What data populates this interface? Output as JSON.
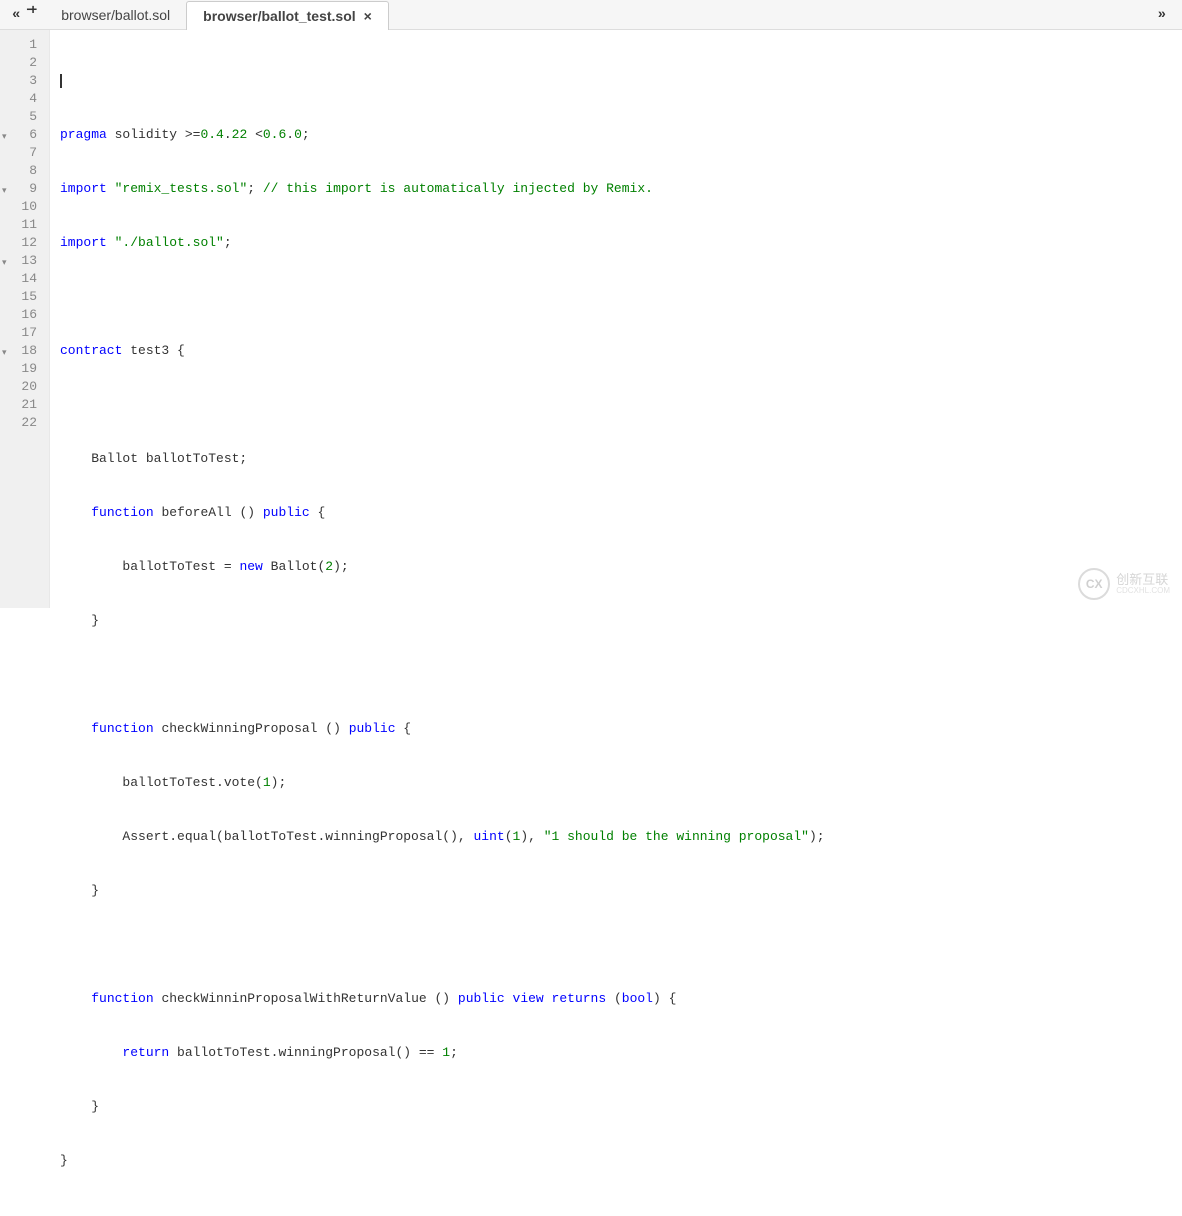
{
  "topbar": {
    "scroll_left": "«",
    "minus": "−",
    "plus": "+",
    "scroll_right": "»"
  },
  "tabs": [
    {
      "label": "browser/ballot.sol",
      "active": false
    },
    {
      "label": "browser/ballot_test.sol",
      "active": true,
      "close": "×"
    }
  ],
  "gutter": {
    "lines": [
      "1",
      "2",
      "3",
      "4",
      "5",
      "6",
      "7",
      "8",
      "9",
      "10",
      "11",
      "12",
      "13",
      "14",
      "15",
      "16",
      "17",
      "18",
      "19",
      "20",
      "21",
      "22"
    ],
    "folds": {
      "5": "▾",
      "8": "▾",
      "12": "▾",
      "17": "▾"
    }
  },
  "code": {
    "l1_cursor": "",
    "l2_a": "pragma",
    "l2_b": " solidity >=",
    "l2_c": "0.4",
    "l2_d": ".",
    "l2_e": "22",
    "l2_f": " <",
    "l2_g": "0.6",
    "l2_h": ".",
    "l2_i": "0",
    "l2_j": ";",
    "l3_a": "import",
    "l3_b": " ",
    "l3_c": "\"remix_tests.sol\"",
    "l3_d": "; ",
    "l3_e": "// this import is automatically injected by Remix.",
    "l4_a": "import",
    "l4_b": " ",
    "l4_c": "\"./ballot.sol\"",
    "l4_d": ";",
    "l6_a": "contract",
    "l6_b": " test3 {",
    "l8_a": "    Ballot ballotToTest;",
    "l9_a": "    ",
    "l9_b": "function",
    "l9_c": " beforeAll () ",
    "l9_d": "public",
    "l9_e": " {",
    "l10_a": "        ballotToTest = ",
    "l10_b": "new",
    "l10_c": " Ballot(",
    "l10_d": "2",
    "l10_e": ");",
    "l11_a": "    }",
    "l13_a": "    ",
    "l13_b": "function",
    "l13_c": " checkWinningProposal () ",
    "l13_d": "public",
    "l13_e": " {",
    "l14_a": "        ballotToTest.vote(",
    "l14_b": "1",
    "l14_c": ");",
    "l15_a": "        Assert.equal(ballotToTest.winningProposal(), ",
    "l15_b": "uint",
    "l15_c": "(",
    "l15_d": "1",
    "l15_e": "), ",
    "l15_f": "\"1 should be the winning proposal\"",
    "l15_g": ");",
    "l16_a": "    }",
    "l18_a": "    ",
    "l18_b": "function",
    "l18_c": " checkWinninProposalWithReturnValue () ",
    "l18_d": "public",
    "l18_e": " ",
    "l18_f": "view",
    "l18_g": " ",
    "l18_h": "returns",
    "l18_i": " (",
    "l18_j": "bool",
    "l18_k": ") {",
    "l19_a": "        ",
    "l19_b": "return",
    "l19_c": " ballotToTest.winningProposal() == ",
    "l19_d": "1",
    "l19_e": ";",
    "l20_a": "    }",
    "l21_a": "}"
  },
  "watermark": {
    "icon": "CX",
    "main": "创新互联",
    "sub": "CDCXHL.COM"
  }
}
